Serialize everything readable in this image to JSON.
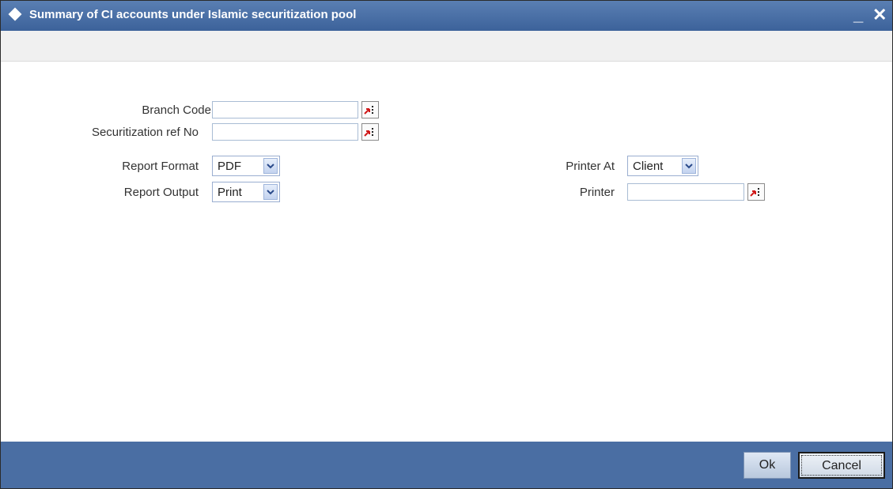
{
  "window": {
    "title": "Summary of CI accounts under Islamic securitization pool",
    "minimize_label": "_",
    "close_label": "✕"
  },
  "form": {
    "branch_code": {
      "label": "Branch Code",
      "required_mark": "*",
      "value": ""
    },
    "securitization_ref": {
      "label": "Securitization ref No",
      "value": ""
    },
    "report_format": {
      "label": "Report Format",
      "selected": "PDF"
    },
    "report_output": {
      "label": "Report Output",
      "selected": "Print"
    },
    "printer_at": {
      "label": "Printer At",
      "selected": "Client"
    },
    "printer": {
      "label": "Printer",
      "value": ""
    }
  },
  "footer": {
    "ok_label": "Ok",
    "cancel_label": "Cancel"
  },
  "icons": {
    "title_icon": "diamond-icon",
    "lov_icon": "list-of-values-icon",
    "dropdown_icon": "chevron-down-icon"
  },
  "colors": {
    "titlebar": "#4a6ea3",
    "footer": "#4a6ea3",
    "required": "#d21b1b"
  }
}
